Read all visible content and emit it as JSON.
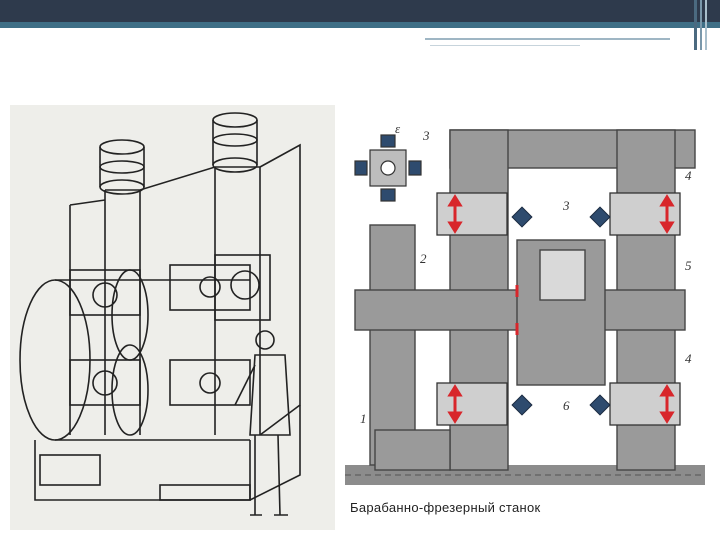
{
  "slide": {
    "caption": "Барабанно-фрезерный станок",
    "accent_color": "#2e3a4c",
    "stripe_color": "#3f6f86",
    "arrow_color": "#d8262b"
  },
  "diagram": {
    "labels": [
      "ε",
      "3",
      "3",
      "4",
      "2",
      "5",
      "4",
      "1",
      "6"
    ]
  }
}
